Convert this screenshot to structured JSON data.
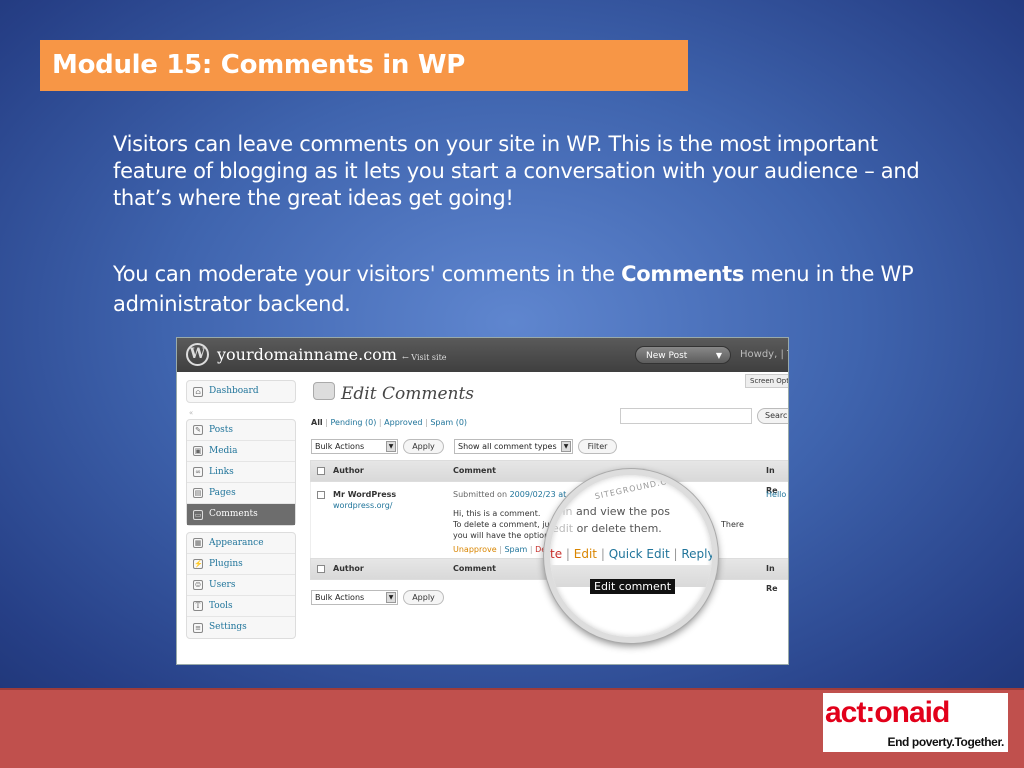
{
  "slide": {
    "title": "Module 15: Comments in WP",
    "paragraph1": "Visitors can leave comments on your site in WP. This is the most important feature of blogging as it lets you start a conversation with your audience – and that’s where the great ideas get going!",
    "paragraph2_before": "You can moderate your visitors' comments in the ",
    "paragraph2_bold": "Comments",
    "paragraph2_after": " menu in the WP administrator backend."
  },
  "wp": {
    "site": "yourdomainname.com",
    "visit_site": "← Visit site",
    "new_post": "New Post",
    "howdy": "Howdy, | T",
    "screen_options": "Screen Opt",
    "page_title": "Edit Comments",
    "menu_group1": [
      "Dashboard"
    ],
    "menu_group2": [
      "Posts",
      "Media",
      "Links",
      "Pages",
      "Comments"
    ],
    "menu_group3": [
      "Appearance",
      "Plugins",
      "Users",
      "Tools",
      "Settings"
    ],
    "status_all": "All",
    "status_pending": "Pending (0)",
    "status_approved": "Approved",
    "status_spam": "Spam (0)",
    "search_button": "Searc",
    "bulk_actions": "Bulk Actions",
    "apply": "Apply",
    "show_all_types": "Show all comment types",
    "filter": "Filter",
    "col_author": "Author",
    "col_comment": "Comment",
    "col_inre": "In Re",
    "comment_author": "Mr WordPress",
    "comment_url": "wordpress.org/",
    "submitted_on": "Submitted on ",
    "submitted_date": "2009/02/23 at",
    "comment_line1": "Hi, this is a comment.",
    "comment_line2": "To delete a comment, ju",
    "comment_line3": "you will have the option",
    "comment_there": "There",
    "act_unapprove": "Unapprove",
    "act_spam": "Spam",
    "act_delete": "De",
    "inre": "Hello"
  },
  "lens": {
    "arc_text": "SITEGROUND.COM",
    "line1_dim": "g in",
    "line1": " and view the pos",
    "line2_dim": "edit",
    "line2": " or delete them.",
    "act_delete_tail": "te",
    "act_edit": "Edit",
    "act_quick_edit": "Quick Edit",
    "act_reply": "Reply",
    "tooltip": "Edit comment"
  },
  "logo": {
    "mark": "act:onaid",
    "tagline": "End poverty.Together."
  },
  "colors": {
    "title_bar": "#f79646",
    "footer": "#c0504d",
    "logo_red": "#e2001a"
  }
}
